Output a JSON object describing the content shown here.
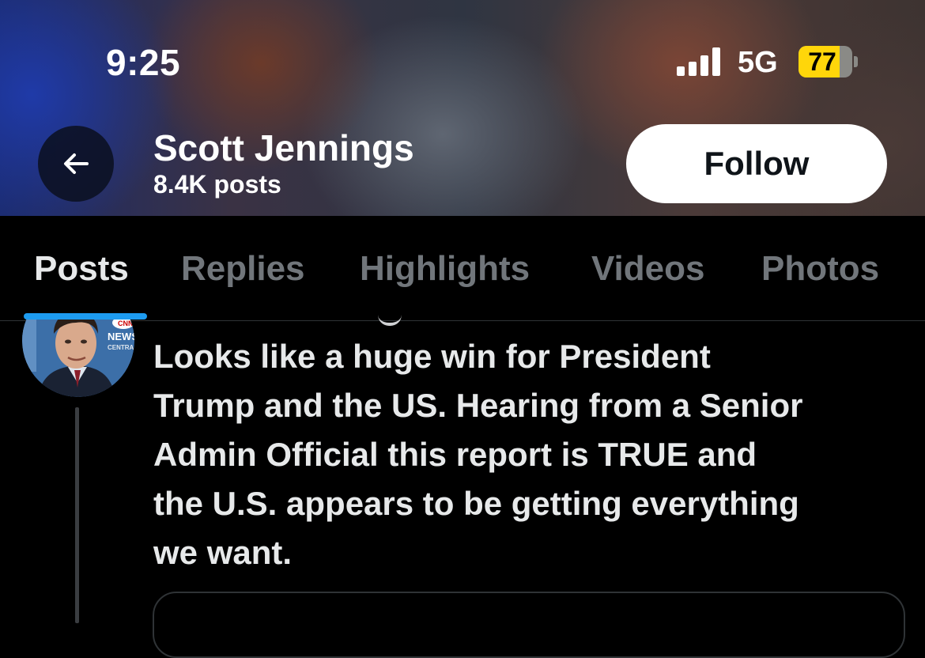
{
  "status_bar": {
    "time": "9:25",
    "network": "5G",
    "battery": "77",
    "battery_level": 0.77
  },
  "profile_header": {
    "name": "Scott Jennings",
    "posts_count": "8.4K posts",
    "follow_label": "Follow",
    "back_icon": "arrow-left-icon"
  },
  "tabs": [
    {
      "label": "Posts",
      "active": true
    },
    {
      "label": "Replies",
      "active": false
    },
    {
      "label": "Highlights",
      "active": false
    },
    {
      "label": "Videos",
      "active": false
    },
    {
      "label": "Photos",
      "active": false
    }
  ],
  "post": {
    "avatar_badge_lines": [
      "CNN",
      "NEWS",
      "CENTRAL"
    ],
    "text": "Looks like a huge win for President\nTrump and the US. Hearing from a Senior\nAdmin Official this report is TRUE and\nthe U.S. appears to be getting everything\nwe want."
  },
  "colors": {
    "accent": "#1d9bf0",
    "battery_fill": "#ffd60a",
    "background": "#000000",
    "inactive_tab": "#71767b"
  }
}
